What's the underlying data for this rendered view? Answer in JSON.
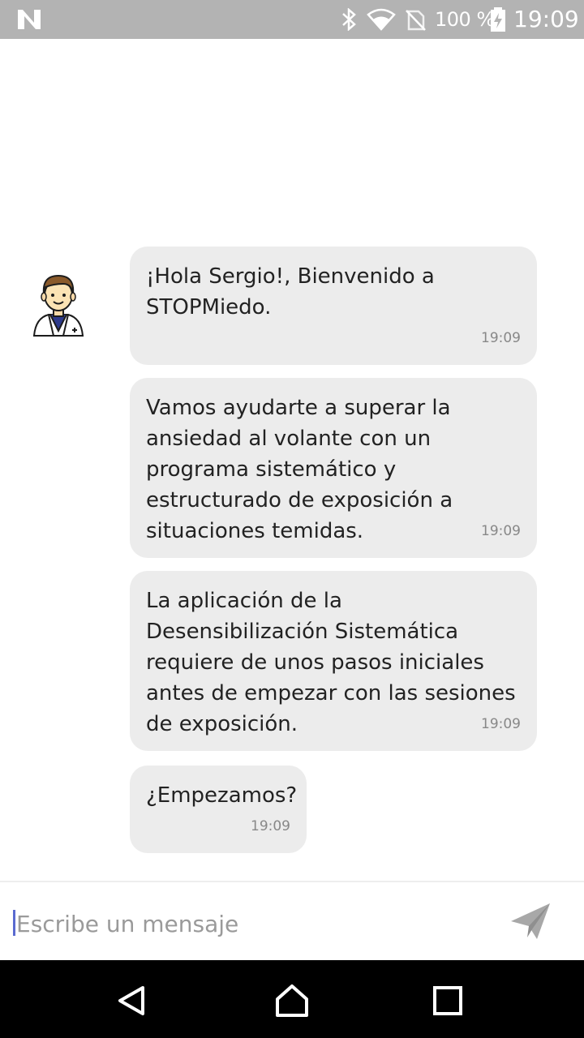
{
  "status_bar": {
    "battery_percent": "100 %",
    "time": "19:09",
    "icons": [
      "n-logo-icon",
      "bluetooth-icon",
      "wifi-icon",
      "no-sim-icon",
      "battery-charging-icon"
    ]
  },
  "chat": {
    "avatar": "doctor-avatar-icon",
    "messages": [
      {
        "text": "¡Hola Sergio!, Bienvenido a STOPMiedo.",
        "time": "19:09"
      },
      {
        "text": "Vamos ayudarte a superar la ansiedad al volante con un programa sistemático y estructurado de exposición a situaciones temidas.",
        "time": "19:09"
      },
      {
        "text": "La aplicación de la Desensibilización Sistemática requiere de unos pasos iniciales antes de empezar con las sesiones de exposición.",
        "time": "19:09"
      },
      {
        "text": "¿Empezamos?",
        "time": "19:09"
      }
    ]
  },
  "composer": {
    "placeholder": "Escribe un mensaje",
    "value": ""
  },
  "nav": {
    "buttons": [
      "back-icon",
      "home-icon",
      "recents-icon"
    ]
  },
  "colors": {
    "status_bar_bg": "#b3b3b3",
    "bubble_bg": "#ececec",
    "nav_bg": "#000000",
    "caret": "#5a6ad0"
  }
}
